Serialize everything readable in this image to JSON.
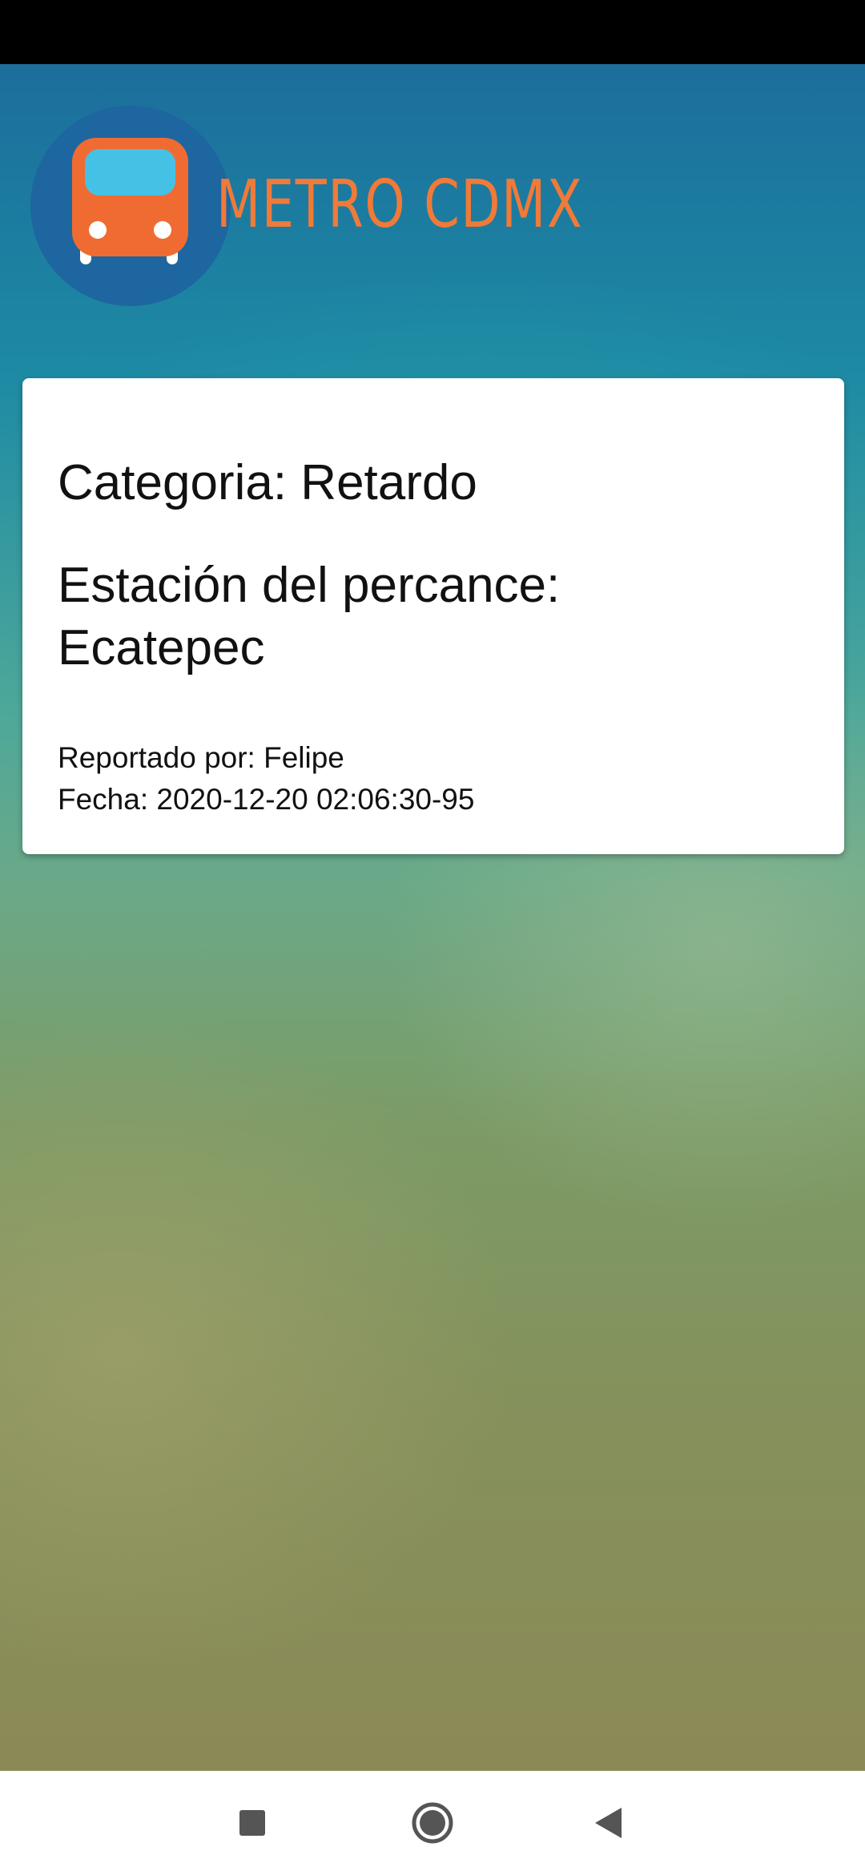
{
  "app": {
    "logo_text": "METRO CDMX",
    "brand_color": "#f07a38",
    "logo_circle_color": "#1e66a0"
  },
  "report": {
    "category_label": "Categoria:",
    "category_value": "Retardo",
    "station_label": "Estación del percance:",
    "station_value": "Ecatepec",
    "reported_by_label": "Reportado por:",
    "reported_by_value": "Felipe",
    "date_label": "Fecha:",
    "date_value": "2020-12-20 02:06:30-95"
  },
  "nav": {
    "recents_icon": "square-icon",
    "home_icon": "circle-home-icon",
    "back_icon": "triangle-back-icon"
  }
}
